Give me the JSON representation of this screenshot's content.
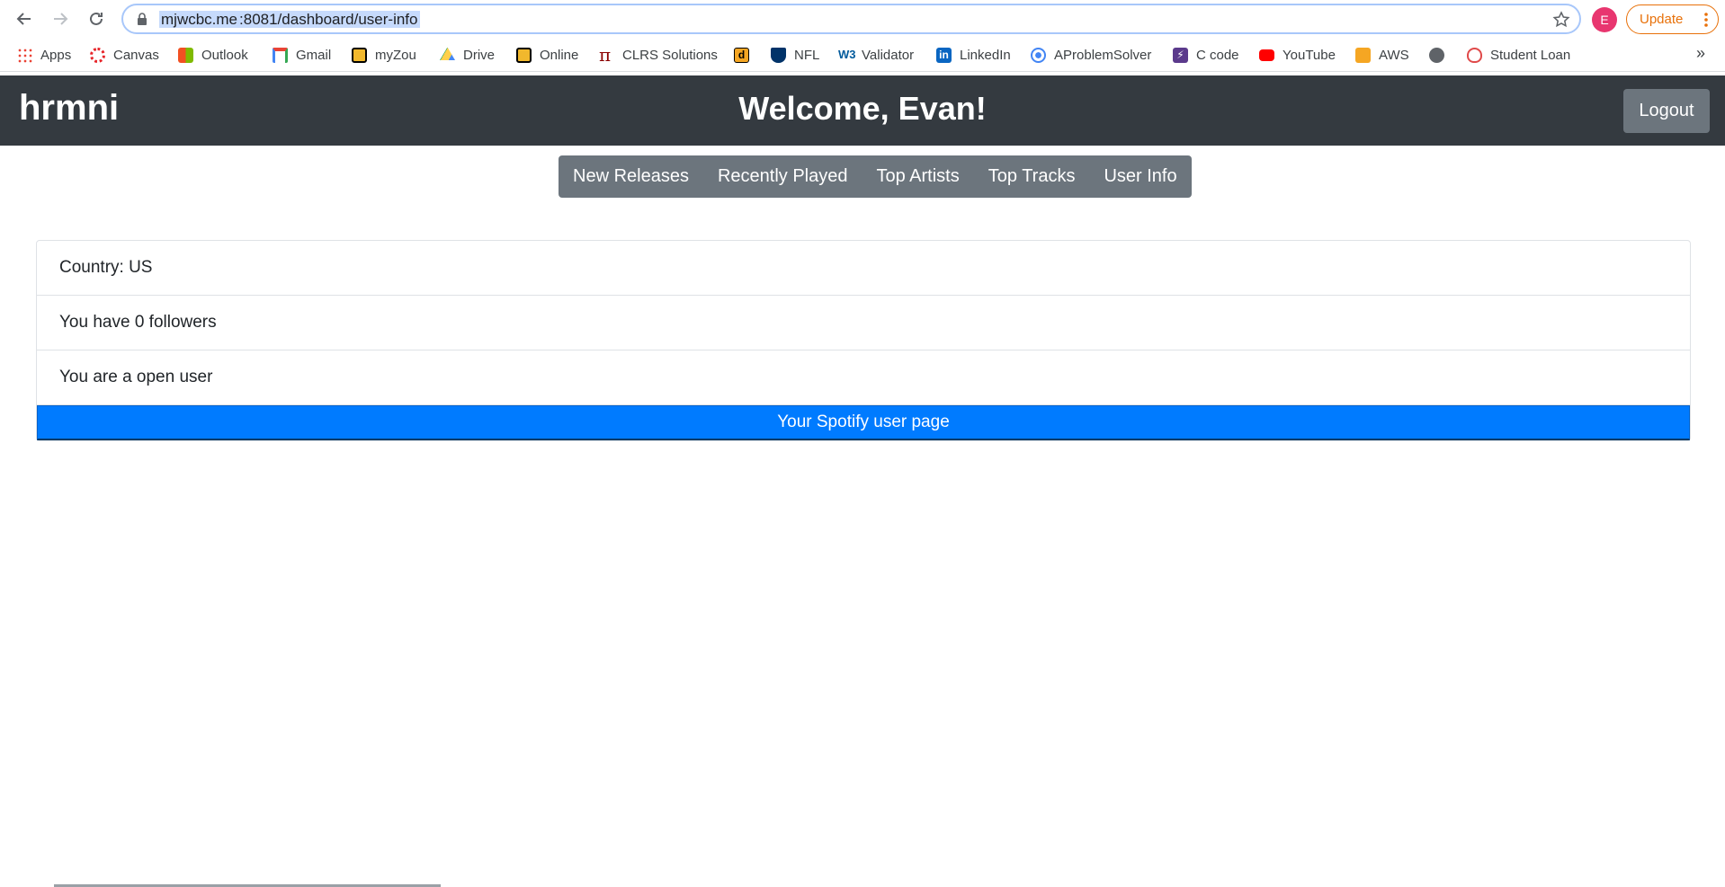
{
  "browser": {
    "url_host": "mjwcbc.me",
    "url_rest": ":8081/dashboard/user-info",
    "profile_initial": "E",
    "update_label": "Update"
  },
  "bookmarks": [
    {
      "label": "Apps",
      "icon": "apps-grid-icon",
      "color": "#4285f4"
    },
    {
      "label": "Canvas",
      "icon": "canvas-icon",
      "color": "#e72429"
    },
    {
      "label": "Outlook",
      "icon": "windows-icon",
      "color": "#f25022"
    },
    {
      "label": "Gmail",
      "icon": "gmail-icon",
      "color": "#ea4335"
    },
    {
      "label": "myZou",
      "icon": "mizzou-icon",
      "color": "#f1b82d"
    },
    {
      "label": "Drive",
      "icon": "drive-icon",
      "color": "#1fa463"
    },
    {
      "label": "Online",
      "icon": "mizzou-icon",
      "color": "#f1b82d"
    },
    {
      "label": "CLRS Solutions",
      "icon": "pi-icon",
      "color": "#8b0000"
    },
    {
      "label": "",
      "icon": "d-icon",
      "color": "#f5a623"
    },
    {
      "label": "NFL",
      "icon": "nfl-icon",
      "color": "#013369"
    },
    {
      "label": "Validator",
      "icon": "w3c-icon",
      "color": "#005a9c"
    },
    {
      "label": "LinkedIn",
      "icon": "linkedin-icon",
      "color": "#0a66c2"
    },
    {
      "label": "AProblemSolver",
      "icon": "circle-icon",
      "color": "#4285f4"
    },
    {
      "label": "C code",
      "icon": "bolt-icon",
      "color": "#5b3a8c"
    },
    {
      "label": "YouTube",
      "icon": "youtube-icon",
      "color": "#ff0000"
    },
    {
      "label": "AWS",
      "icon": "box-icon",
      "color": "#f5a623"
    },
    {
      "label": "",
      "icon": "globe-icon",
      "color": "#5f6368"
    },
    {
      "label": "Student Loan",
      "icon": "apple-icon",
      "color": "#e04a4a"
    }
  ],
  "header": {
    "brand": "hrmni",
    "welcome": "Welcome, Evan!",
    "logout_label": "Logout"
  },
  "tabs": [
    "New Releases",
    "Recently Played",
    "Top Artists",
    "Top Tracks",
    "User Info"
  ],
  "info": {
    "country": "Country: US",
    "followers": "You have 0 followers",
    "product": "You are a open user",
    "action_label": "Your Spotify user page"
  }
}
